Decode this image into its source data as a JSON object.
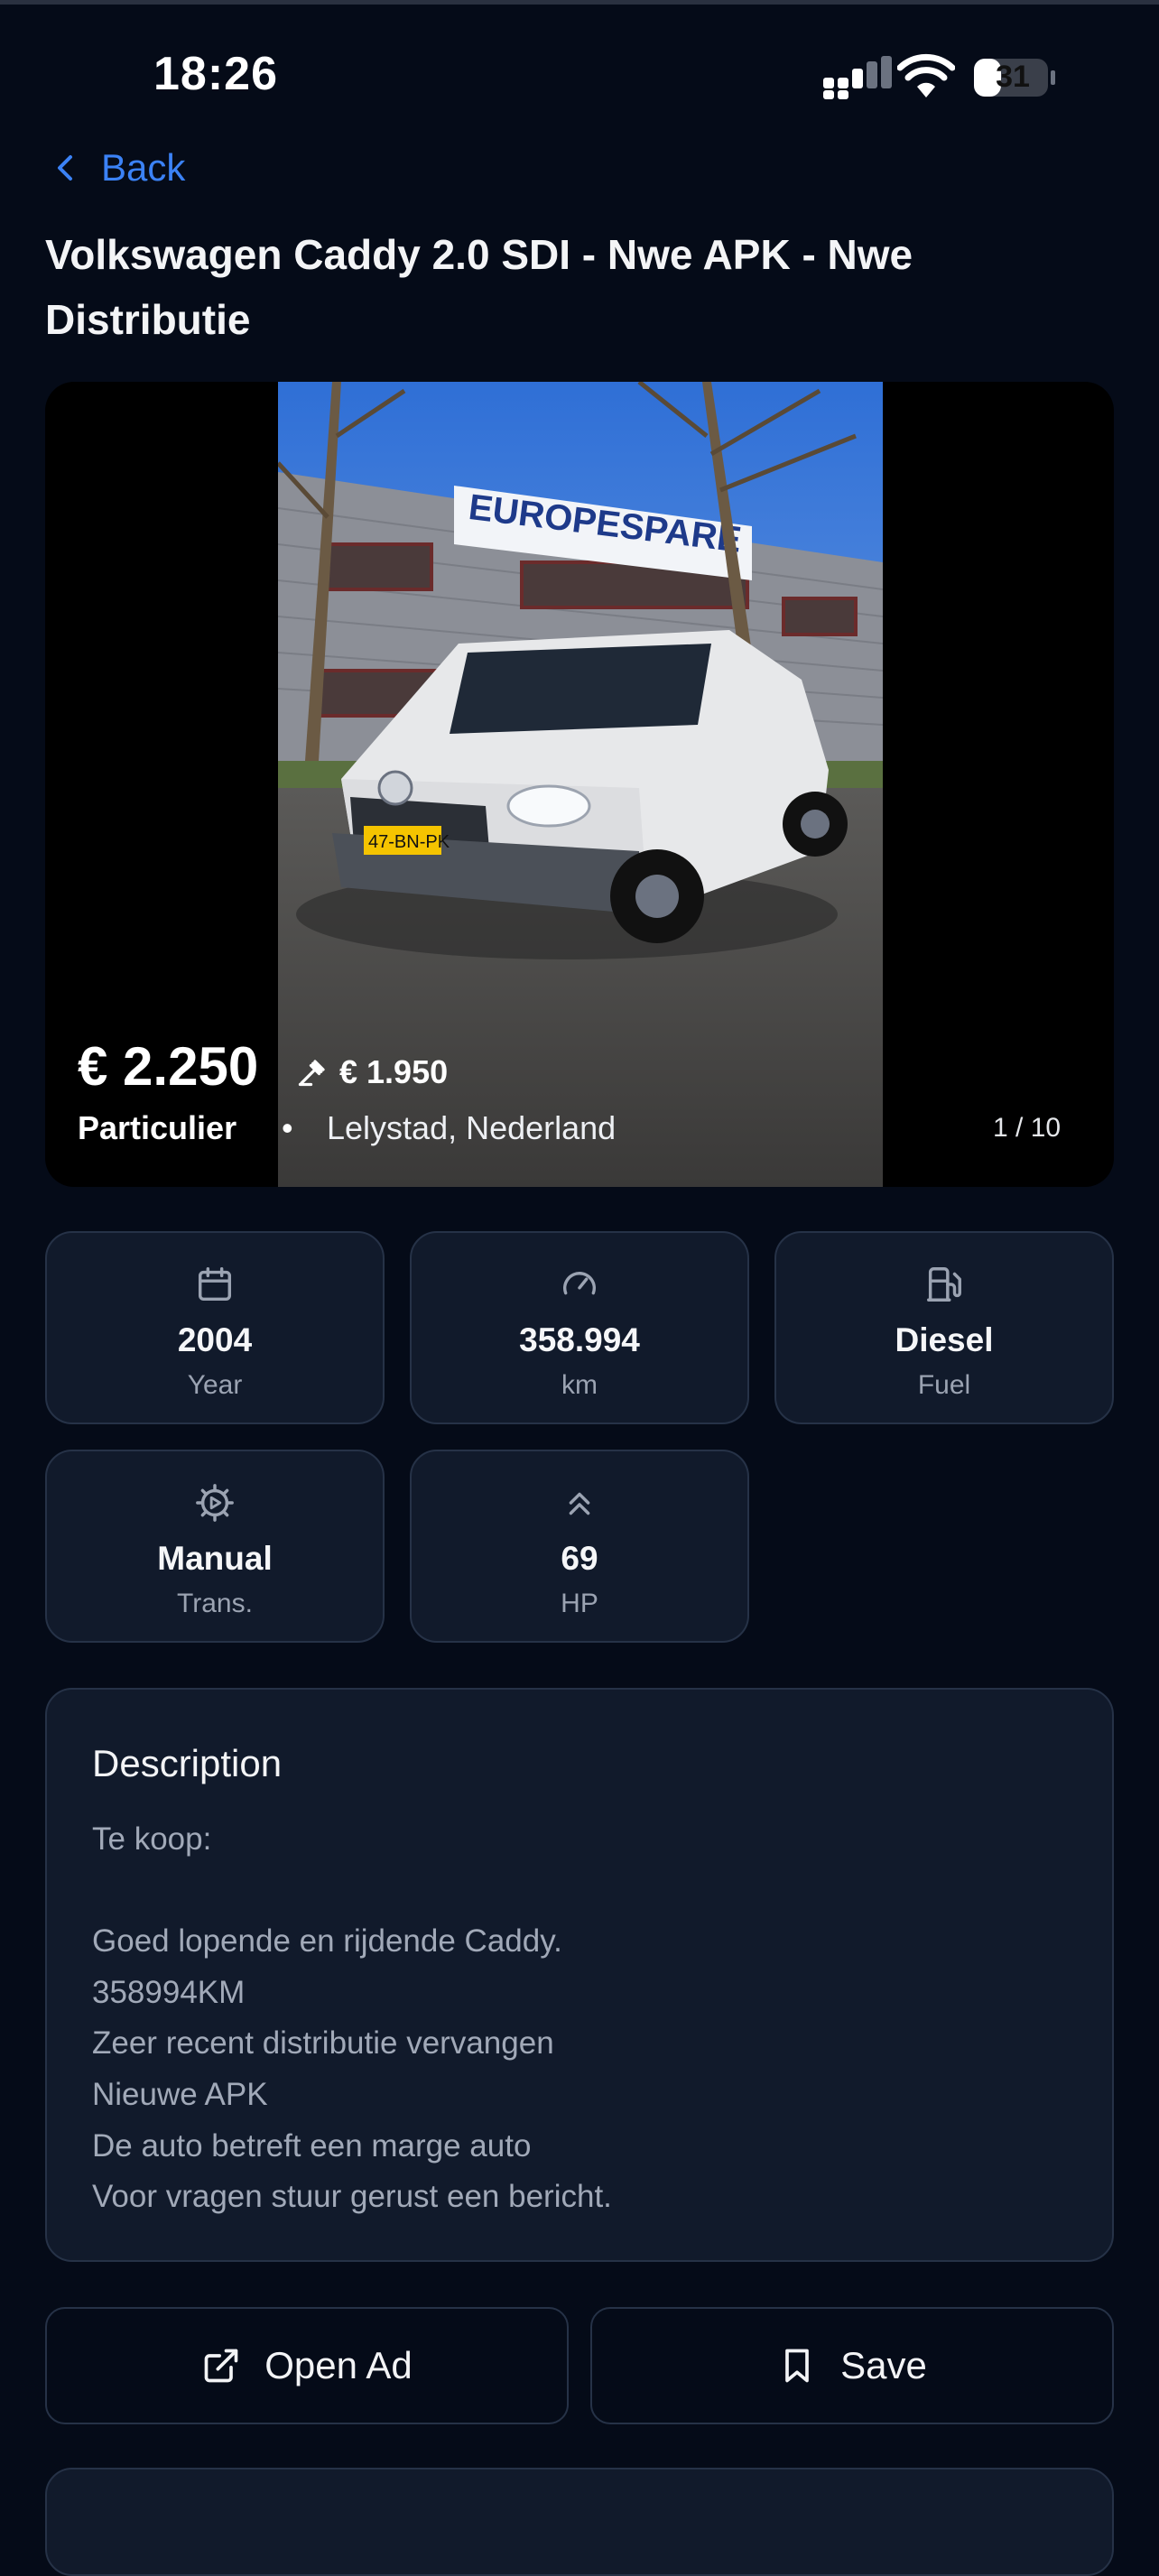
{
  "status_bar": {
    "time": "18:26",
    "battery": "31"
  },
  "nav": {
    "back_label": "Back"
  },
  "listing": {
    "title": "Volkswagen Caddy 2.0 SDI - Nwe APK - Nwe Distributie",
    "price": "€ 2.250",
    "bid": "€ 1.950",
    "seller_type": "Particulier",
    "separator": "•",
    "location": "Lelystad, Nederland",
    "photo_counter": "1 / 10",
    "photo_sign_text": "EUROPESPARE",
    "photo_plate_text": "47-BN-PK"
  },
  "specs": [
    {
      "icon": "calendar-icon",
      "value": "2004",
      "label": "Year"
    },
    {
      "icon": "speedometer-icon",
      "value": "358.994",
      "label": "km"
    },
    {
      "icon": "fuel-pump-icon",
      "value": "Diesel",
      "label": "Fuel"
    },
    {
      "icon": "gear-icon",
      "value": "Manual",
      "label": "Trans."
    },
    {
      "icon": "chevrons-up-icon",
      "value": "69",
      "label": "HP"
    }
  ],
  "description": {
    "heading": "Description",
    "text": "Te koop:\n\nGoed lopende en rijdende Caddy.\n358994KM\nZeer recent distributie vervangen\nNieuwe APK\nDe auto betreft een marge auto\nVoor vragen stuur gerust een bericht."
  },
  "actions": {
    "open_ad_label": "Open Ad",
    "save_label": "Save"
  },
  "colors": {
    "background": "#050b18",
    "card": "#111a2b",
    "accent": "#3b82f6",
    "muted_text": "#9ba3b2"
  }
}
